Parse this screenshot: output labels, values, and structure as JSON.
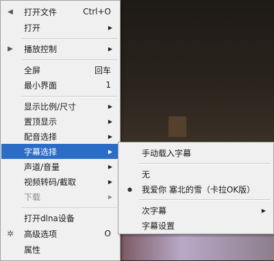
{
  "main_menu": {
    "items": [
      {
        "label": "打开文件",
        "shortcut": "Ctrl+O"
      },
      {
        "label": "打开"
      },
      {
        "label": "播放控制"
      },
      {
        "label": "全屏",
        "shortcut": "回车"
      },
      {
        "label": "最小界面",
        "shortcut": "1"
      },
      {
        "label": "显示比例/尺寸"
      },
      {
        "label": "置顶显示"
      },
      {
        "label": "配音选择"
      },
      {
        "label": "字幕选择"
      },
      {
        "label": "声道/音量"
      },
      {
        "label": "视频转码/截取"
      },
      {
        "label": "下载"
      },
      {
        "label": "打开dlna设备"
      },
      {
        "label": "高级选项",
        "shortcut": "O"
      },
      {
        "label": "属性"
      }
    ]
  },
  "subtitle_menu": {
    "items": [
      {
        "label": "手动载入字幕"
      },
      {
        "label": "无"
      },
      {
        "label": "我爱你 塞北的雪（卡拉OK版）"
      },
      {
        "label": "次字幕"
      },
      {
        "label": "字幕设置"
      }
    ]
  },
  "icons": {
    "open_file": "open-file-icon",
    "playback": "play-triangle-icon",
    "advanced": "gear-icon",
    "submenu": "chevron-right-icon",
    "selected": "radio-dot-icon"
  },
  "colors": {
    "highlight": "#2a6cc6",
    "menu_bg": "#f0f0f0",
    "disabled": "#8c8c8c"
  }
}
